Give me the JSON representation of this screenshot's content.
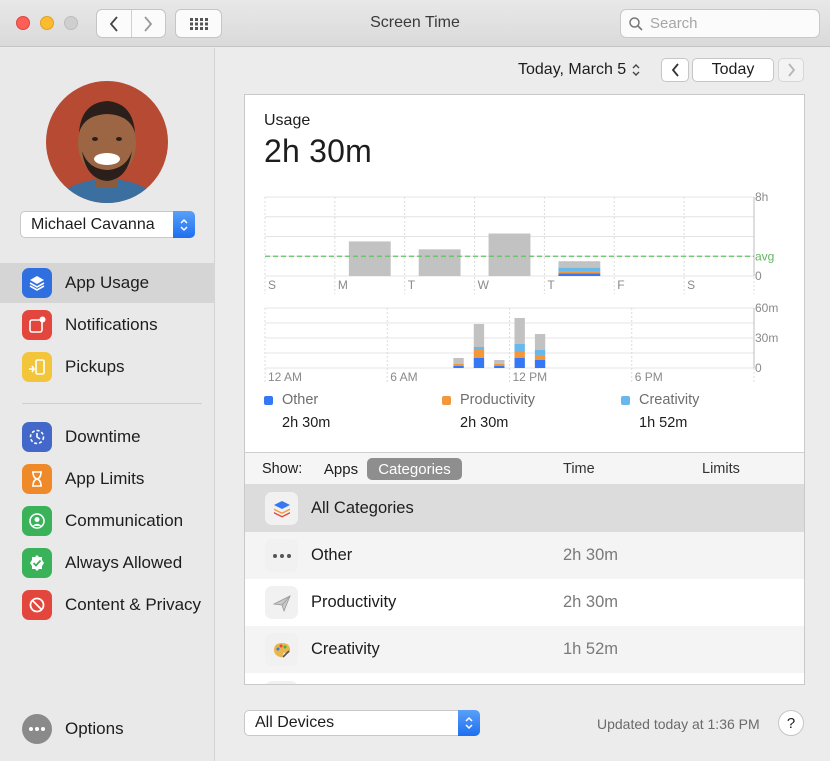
{
  "window": {
    "title": "Screen Time",
    "search_placeholder": "Search"
  },
  "sidebar": {
    "user_name": "Michael Cavanna",
    "items": [
      {
        "label": "App Usage",
        "icon": "layers-icon",
        "color": "#2f6fdf",
        "selected": true
      },
      {
        "label": "Notifications",
        "icon": "notification-badge-icon",
        "color": "#e2463c"
      },
      {
        "label": "Pickups",
        "icon": "pickup-phone-icon",
        "color": "#f3c53a"
      },
      {
        "label": "Downtime",
        "icon": "downtime-clock-icon",
        "color": "#4368c9"
      },
      {
        "label": "App Limits",
        "icon": "hourglass-icon",
        "color": "#ef8a2b"
      },
      {
        "label": "Communication",
        "icon": "person-circle-icon",
        "color": "#39b25a"
      },
      {
        "label": "Always Allowed",
        "icon": "check-badge-icon",
        "color": "#39b25a"
      },
      {
        "label": "Content & Privacy",
        "icon": "no-entry-icon",
        "color": "#e2463c"
      }
    ],
    "options_label": "Options"
  },
  "header": {
    "date_label": "Today, March 5",
    "today_button": "Today"
  },
  "usage": {
    "label": "Usage",
    "total": "2h 30m"
  },
  "chart_data": [
    {
      "type": "bar",
      "categories": [
        "S",
        "M",
        "T",
        "W",
        "T",
        "F",
        "S"
      ],
      "series": [
        {
          "values": [
            0,
            3.5,
            2.7,
            4.3,
            0,
            0,
            0
          ]
        },
        {
          "name": "Other",
          "values": [
            0,
            0,
            0,
            0,
            0.25,
            0,
            0
          ]
        },
        {
          "name": "Productivity",
          "values": [
            0,
            0,
            0,
            0,
            0.25,
            0,
            0
          ]
        },
        {
          "name": "Creativity",
          "values": [
            0,
            0,
            0,
            0,
            0.35,
            0,
            0
          ]
        }
      ],
      "gray_extra_today": 0.65,
      "ylim": [
        0,
        8
      ],
      "y_ticks": [
        "8h",
        "avg",
        "0"
      ],
      "avg_value": 2.0
    },
    {
      "type": "bar",
      "x_ticks": [
        "12 AM",
        "6 AM",
        "12 PM",
        "6 PM"
      ],
      "y_ticks": [
        "60m",
        "30m",
        "0"
      ],
      "ylim": [
        0,
        60
      ],
      "hours": [
        9,
        10,
        11,
        12,
        13
      ],
      "series": [
        {
          "name": "Other",
          "values": [
            2,
            10,
            2,
            10,
            8
          ]
        },
        {
          "name": "Productivity",
          "values": [
            2,
            8,
            2,
            6,
            5
          ]
        },
        {
          "name": "Creativity",
          "values": [
            0,
            3,
            0,
            8,
            5
          ]
        },
        {
          "values": [
            6,
            23,
            4,
            26,
            16
          ]
        }
      ]
    }
  ],
  "legend": [
    {
      "name": "Other",
      "color": "#3478f6",
      "time": "2h 30m"
    },
    {
      "name": "Productivity",
      "color": "#f3973a",
      "time": "2h 30m"
    },
    {
      "name": "Creativity",
      "color": "#67b9ec",
      "time": "1h 52m"
    }
  ],
  "table": {
    "show_label": "Show:",
    "seg_apps": "Apps",
    "seg_categories": "Categories",
    "col_time": "Time",
    "col_limits": "Limits",
    "rows": [
      {
        "name": "All Categories",
        "time": "",
        "icon": "stack-icon"
      },
      {
        "name": "Other",
        "time": "2h 30m",
        "icon": "ellipsis-icon"
      },
      {
        "name": "Productivity",
        "time": "2h 30m",
        "icon": "paper-plane-icon"
      },
      {
        "name": "Creativity",
        "time": "1h 52m",
        "icon": "palette-icon"
      }
    ]
  },
  "footer": {
    "devices": "All Devices",
    "updated": "Updated today at 1:36 PM",
    "help": "?"
  }
}
